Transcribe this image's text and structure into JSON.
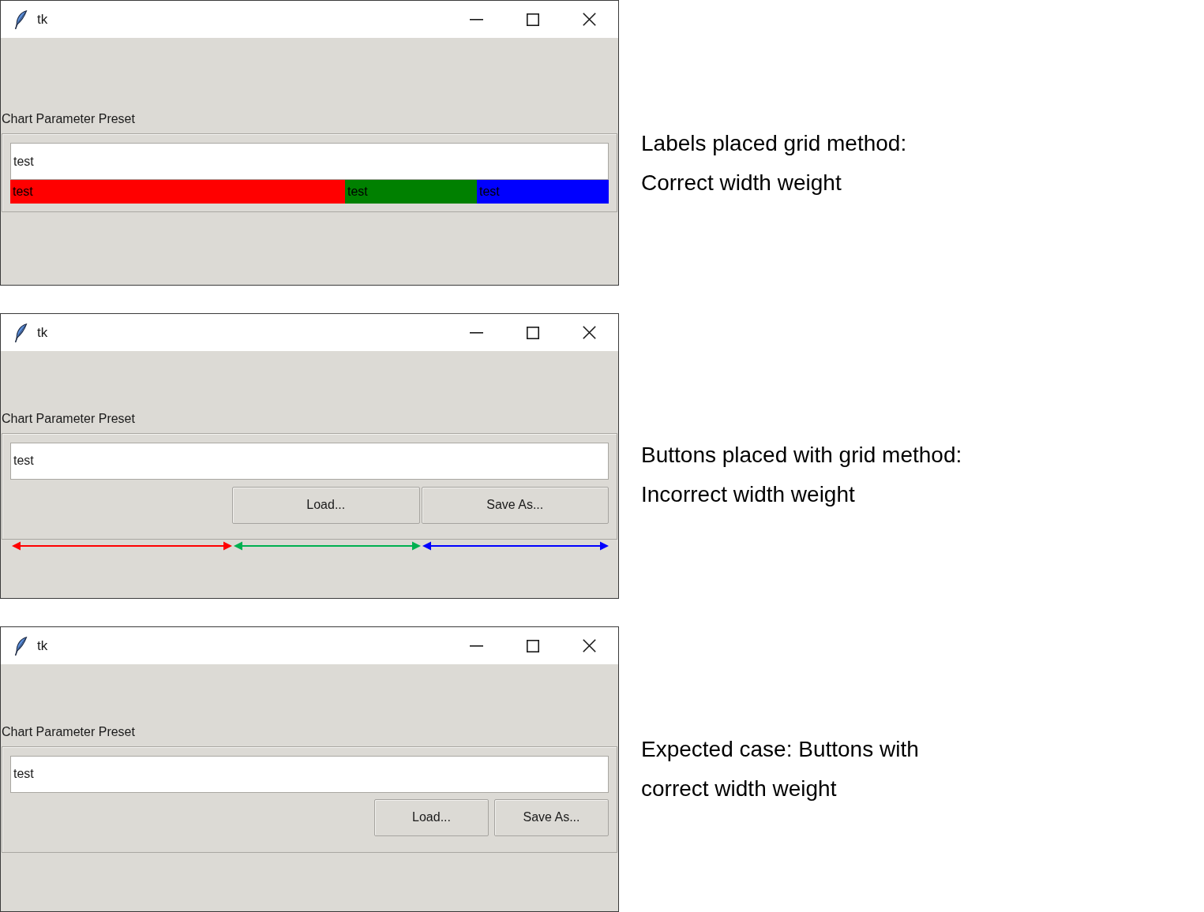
{
  "panels": [
    {
      "kind": "colored_labels",
      "window": {
        "title": "tk"
      },
      "section_label": "Chart Parameter Preset",
      "entry": {
        "value": "test"
      },
      "cells": [
        {
          "text": "test",
          "color": "#ff0000"
        },
        {
          "text": "test",
          "color": "#008000"
        },
        {
          "text": "test",
          "color": "#0000ff"
        }
      ],
      "caption": [
        "Labels placed grid method:",
        "Correct width weight"
      ]
    },
    {
      "kind": "stretched_buttons",
      "window": {
        "title": "tk"
      },
      "section_label": "Chart Parameter Preset",
      "entry": {
        "value": "test"
      },
      "buttons": [
        "Load...",
        "Save As..."
      ],
      "arrows": [
        {
          "color": "#ff0000"
        },
        {
          "color": "#00b050"
        },
        {
          "color": "#0000ff"
        }
      ],
      "caption": [
        "Buttons placed with grid method:",
        "Incorrect width weight"
      ]
    },
    {
      "kind": "packed_buttons",
      "window": {
        "title": "tk"
      },
      "section_label": "Chart Parameter Preset",
      "entry": {
        "value": "test"
      },
      "buttons": [
        "Load...",
        "Save As..."
      ],
      "caption": [
        "Expected case: Buttons with",
        "correct width weight"
      ]
    }
  ]
}
